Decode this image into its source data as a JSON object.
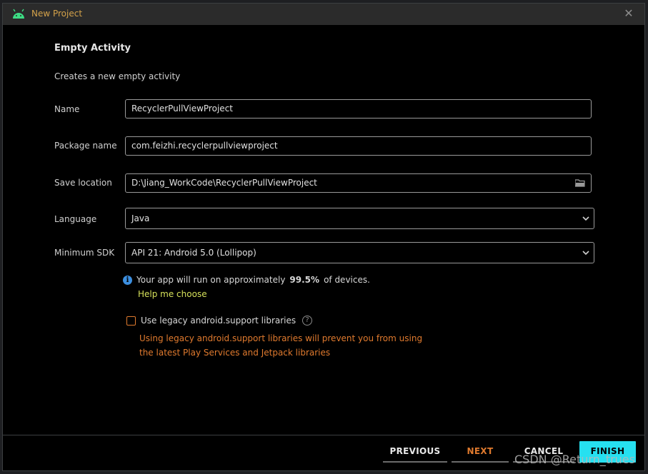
{
  "window": {
    "title": "New Project",
    "close_symbol": "✕"
  },
  "template": {
    "heading": "Empty Activity",
    "description": "Creates a new empty activity"
  },
  "form": {
    "name_label": "Name",
    "name_value": "RecyclerPullViewProject",
    "package_label": "Package name",
    "package_value": "com.feizhi.recyclerpullviewproject",
    "save_label": "Save location",
    "save_value": "D:\\Jiang_WorkCode\\RecyclerPullViewProject",
    "language_label": "Language",
    "language_value": "Java",
    "min_sdk_label": "Minimum SDK",
    "min_sdk_value": "API 21: Android 5.0 (Lollipop)"
  },
  "info": {
    "prefix": "Your app will run on approximately",
    "percent": "99.5%",
    "suffix": "of devices.",
    "help_link": "Help me choose"
  },
  "legacy": {
    "checkbox_label": "Use legacy android.support libraries",
    "checked": false,
    "warning_line1": "Using legacy android.support libraries will prevent you from using",
    "warning_line2": "the latest Play Services and Jetpack libraries"
  },
  "buttons": {
    "previous": "PREVIOUS",
    "next": "NEXT",
    "cancel": "CANCEL",
    "finish": "FINISH"
  },
  "watermark": "CSDN @Return_trues",
  "colors": {
    "accent_orange": "#e07a2e",
    "finish_cyan": "#26e0f0",
    "link_yellow": "#d5e05a",
    "info_blue": "#3c8fe0"
  },
  "icons": {
    "app": "android-icon",
    "folder": "folder-icon",
    "dropdown": "chevron-down-icon",
    "info": "info-icon",
    "help": "question-icon"
  }
}
